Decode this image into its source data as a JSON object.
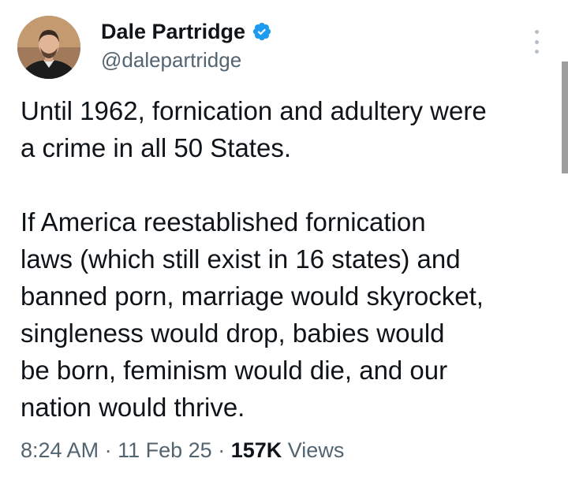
{
  "author": {
    "display_name": "Dale Partridge",
    "handle": "@dalepartridge",
    "verified": true,
    "verified_color": "#1d9bf0"
  },
  "tweet": {
    "paragraphs": [
      "Until 1962, fornication and adultery were\na crime in all 50 States.",
      "If America reestablished fornication\nlaws (which still exist in 16 states) and\nbanned porn, marriage would skyrocket,\nsingleness would drop, babies would\nbe born, feminism would die, and our\nnation would thrive."
    ]
  },
  "meta": {
    "time": "8:24 AM",
    "separator": "·",
    "date": "11 Feb 25",
    "views_count": "157K",
    "views_label": "Views"
  },
  "icons": {
    "verified": "verified-badge-icon",
    "more": "more-options-icon"
  }
}
